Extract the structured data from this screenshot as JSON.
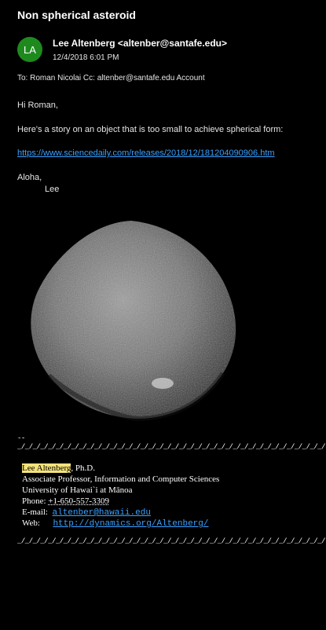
{
  "email": {
    "subject": "Non spherical asteroid",
    "avatar_initials": "LA",
    "sender": "Lee Altenberg <altenber@santafe.edu>",
    "date": "12/4/2018 6:01 PM",
    "recipients": "To: Roman Nicolai Cc: altenber@santafe.edu Account",
    "greeting": "Hi Roman,",
    "intro": "Here's a story on an object that is too small to achieve spherical form:",
    "link": "https://www.sciencedaily.com/releases/2018/12/181204090906.htm",
    "closing": "Aloha,",
    "closing_name": "Lee"
  },
  "signature": {
    "dash": "--",
    "divider": "_/_/_/_/_/_/_/_/_/_/_/_/_/_/_/_/_/_/_/_/_/_/_/_/_/_/_/_/_/_/_/_/_/_/_/_/_/_/_/_/",
    "name": "Lee Altenberg",
    "degree": ", Ph.D.",
    "title": "Associate Professor, Information and Computer Sciences",
    "university": "University of Hawai`i at Mānoa",
    "phone_label": "Phone: ",
    "phone": "+1-650-557-3309",
    "email_label": "E-mail:",
    "email": "altenber@hawaii.edu",
    "web_label": "Web:",
    "web": "http://dynamics.org/Altenberg/"
  },
  "colors": {
    "background": "#000000",
    "link": "#3aa0ff",
    "avatar": "#1e8a1e",
    "highlight": "#f4e27a"
  }
}
